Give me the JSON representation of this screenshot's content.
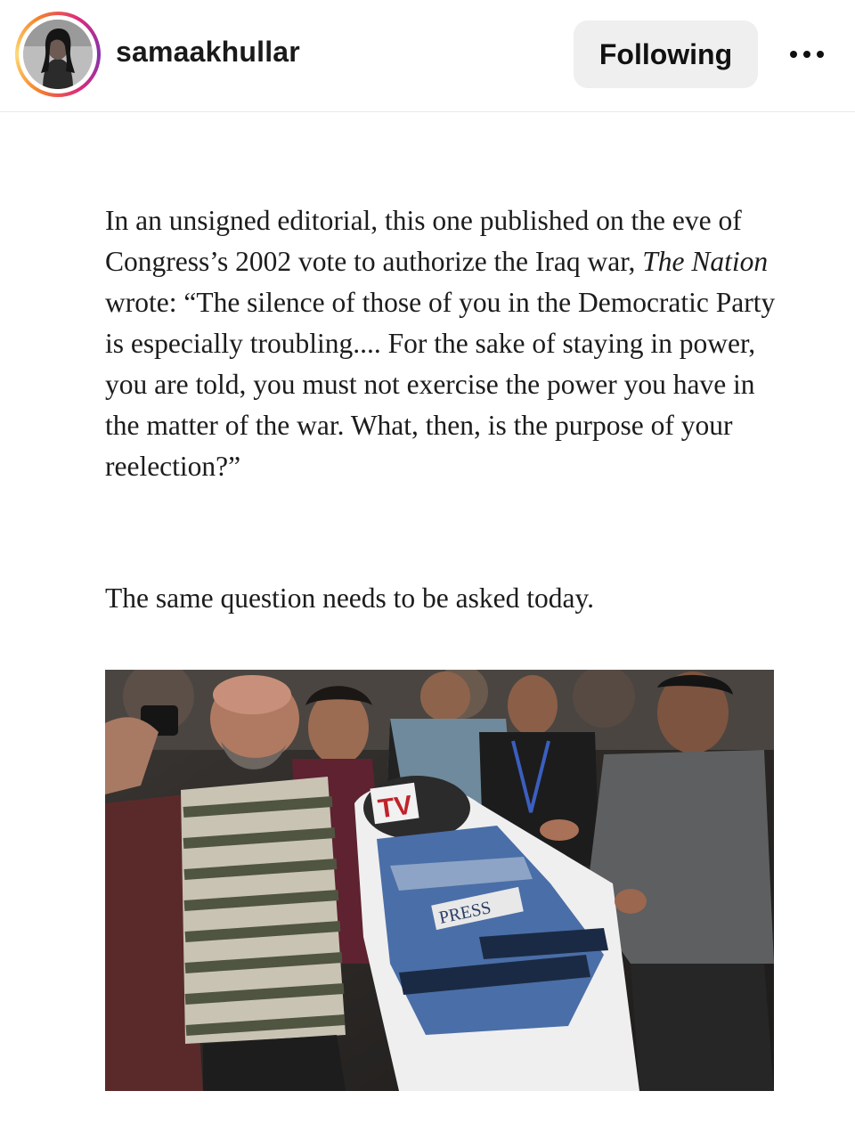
{
  "header": {
    "username": "samaakhullar",
    "follow_label": "Following",
    "avatar_icon": "profile-photo",
    "more_icon": "more-options-icon",
    "ring_colors": [
      "#f58529",
      "#feda77",
      "#dd2a7b",
      "#8134af"
    ]
  },
  "post": {
    "quote_part1": "In an unsigned editorial, this one published on the eve of Congress’s 2002 vote to authorize the Iraq war, ",
    "quote_publication": "The Nation",
    "quote_part2": " wrote: “The silence of those of you in the Democratic Party is especially troubling.... For the sake of staying in power, you are told, you must not exercise the power you have in the matter of the war. What, then, is the purpose of your reelection?”",
    "closing_line": "The same question needs to be asked today.",
    "photo": {
      "helmet_text": "TV",
      "vest_text": "PRESS"
    }
  }
}
